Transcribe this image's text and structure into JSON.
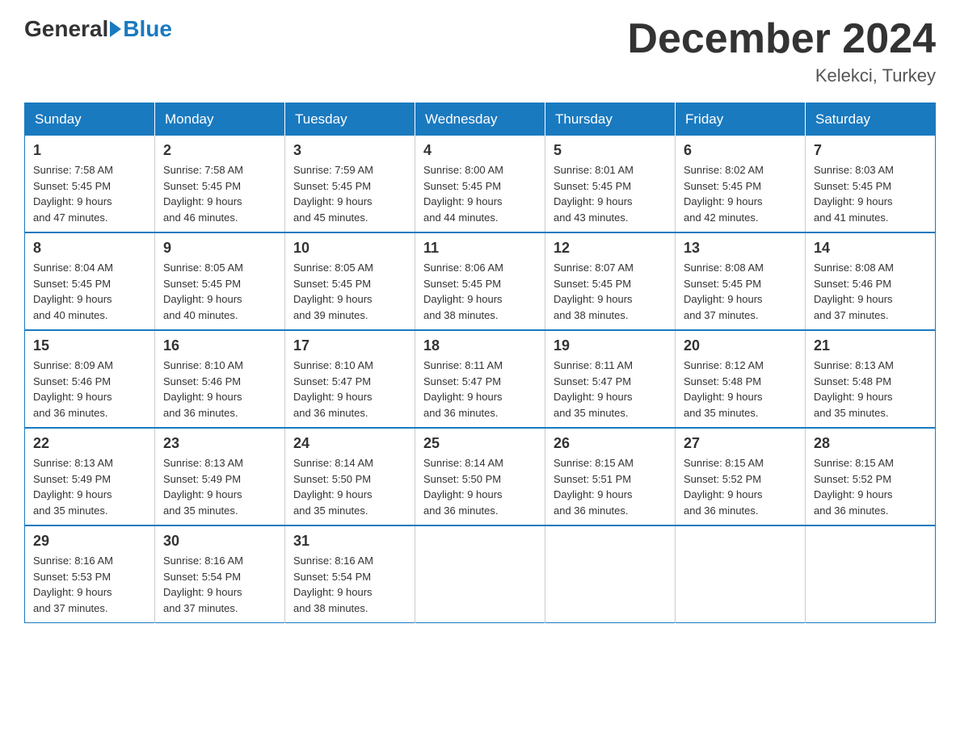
{
  "header": {
    "logo_general": "General",
    "logo_blue": "Blue",
    "month_title": "December 2024",
    "location": "Kelekci, Turkey"
  },
  "days_of_week": [
    "Sunday",
    "Monday",
    "Tuesday",
    "Wednesday",
    "Thursday",
    "Friday",
    "Saturday"
  ],
  "weeks": [
    [
      {
        "day": "1",
        "sunrise": "7:58 AM",
        "sunset": "5:45 PM",
        "daylight": "9 hours and 47 minutes."
      },
      {
        "day": "2",
        "sunrise": "7:58 AM",
        "sunset": "5:45 PM",
        "daylight": "9 hours and 46 minutes."
      },
      {
        "day": "3",
        "sunrise": "7:59 AM",
        "sunset": "5:45 PM",
        "daylight": "9 hours and 45 minutes."
      },
      {
        "day": "4",
        "sunrise": "8:00 AM",
        "sunset": "5:45 PM",
        "daylight": "9 hours and 44 minutes."
      },
      {
        "day": "5",
        "sunrise": "8:01 AM",
        "sunset": "5:45 PM",
        "daylight": "9 hours and 43 minutes."
      },
      {
        "day": "6",
        "sunrise": "8:02 AM",
        "sunset": "5:45 PM",
        "daylight": "9 hours and 42 minutes."
      },
      {
        "day": "7",
        "sunrise": "8:03 AM",
        "sunset": "5:45 PM",
        "daylight": "9 hours and 41 minutes."
      }
    ],
    [
      {
        "day": "8",
        "sunrise": "8:04 AM",
        "sunset": "5:45 PM",
        "daylight": "9 hours and 40 minutes."
      },
      {
        "day": "9",
        "sunrise": "8:05 AM",
        "sunset": "5:45 PM",
        "daylight": "9 hours and 40 minutes."
      },
      {
        "day": "10",
        "sunrise": "8:05 AM",
        "sunset": "5:45 PM",
        "daylight": "9 hours and 39 minutes."
      },
      {
        "day": "11",
        "sunrise": "8:06 AM",
        "sunset": "5:45 PM",
        "daylight": "9 hours and 38 minutes."
      },
      {
        "day": "12",
        "sunrise": "8:07 AM",
        "sunset": "5:45 PM",
        "daylight": "9 hours and 38 minutes."
      },
      {
        "day": "13",
        "sunrise": "8:08 AM",
        "sunset": "5:45 PM",
        "daylight": "9 hours and 37 minutes."
      },
      {
        "day": "14",
        "sunrise": "8:08 AM",
        "sunset": "5:46 PM",
        "daylight": "9 hours and 37 minutes."
      }
    ],
    [
      {
        "day": "15",
        "sunrise": "8:09 AM",
        "sunset": "5:46 PM",
        "daylight": "9 hours and 36 minutes."
      },
      {
        "day": "16",
        "sunrise": "8:10 AM",
        "sunset": "5:46 PM",
        "daylight": "9 hours and 36 minutes."
      },
      {
        "day": "17",
        "sunrise": "8:10 AM",
        "sunset": "5:47 PM",
        "daylight": "9 hours and 36 minutes."
      },
      {
        "day": "18",
        "sunrise": "8:11 AM",
        "sunset": "5:47 PM",
        "daylight": "9 hours and 36 minutes."
      },
      {
        "day": "19",
        "sunrise": "8:11 AM",
        "sunset": "5:47 PM",
        "daylight": "9 hours and 35 minutes."
      },
      {
        "day": "20",
        "sunrise": "8:12 AM",
        "sunset": "5:48 PM",
        "daylight": "9 hours and 35 minutes."
      },
      {
        "day": "21",
        "sunrise": "8:13 AM",
        "sunset": "5:48 PM",
        "daylight": "9 hours and 35 minutes."
      }
    ],
    [
      {
        "day": "22",
        "sunrise": "8:13 AM",
        "sunset": "5:49 PM",
        "daylight": "9 hours and 35 minutes."
      },
      {
        "day": "23",
        "sunrise": "8:13 AM",
        "sunset": "5:49 PM",
        "daylight": "9 hours and 35 minutes."
      },
      {
        "day": "24",
        "sunrise": "8:14 AM",
        "sunset": "5:50 PM",
        "daylight": "9 hours and 35 minutes."
      },
      {
        "day": "25",
        "sunrise": "8:14 AM",
        "sunset": "5:50 PM",
        "daylight": "9 hours and 36 minutes."
      },
      {
        "day": "26",
        "sunrise": "8:15 AM",
        "sunset": "5:51 PM",
        "daylight": "9 hours and 36 minutes."
      },
      {
        "day": "27",
        "sunrise": "8:15 AM",
        "sunset": "5:52 PM",
        "daylight": "9 hours and 36 minutes."
      },
      {
        "day": "28",
        "sunrise": "8:15 AM",
        "sunset": "5:52 PM",
        "daylight": "9 hours and 36 minutes."
      }
    ],
    [
      {
        "day": "29",
        "sunrise": "8:16 AM",
        "sunset": "5:53 PM",
        "daylight": "9 hours and 37 minutes."
      },
      {
        "day": "30",
        "sunrise": "8:16 AM",
        "sunset": "5:54 PM",
        "daylight": "9 hours and 37 minutes."
      },
      {
        "day": "31",
        "sunrise": "8:16 AM",
        "sunset": "5:54 PM",
        "daylight": "9 hours and 38 minutes."
      },
      null,
      null,
      null,
      null
    ]
  ],
  "labels": {
    "sunrise": "Sunrise:",
    "sunset": "Sunset:",
    "daylight": "Daylight:"
  }
}
